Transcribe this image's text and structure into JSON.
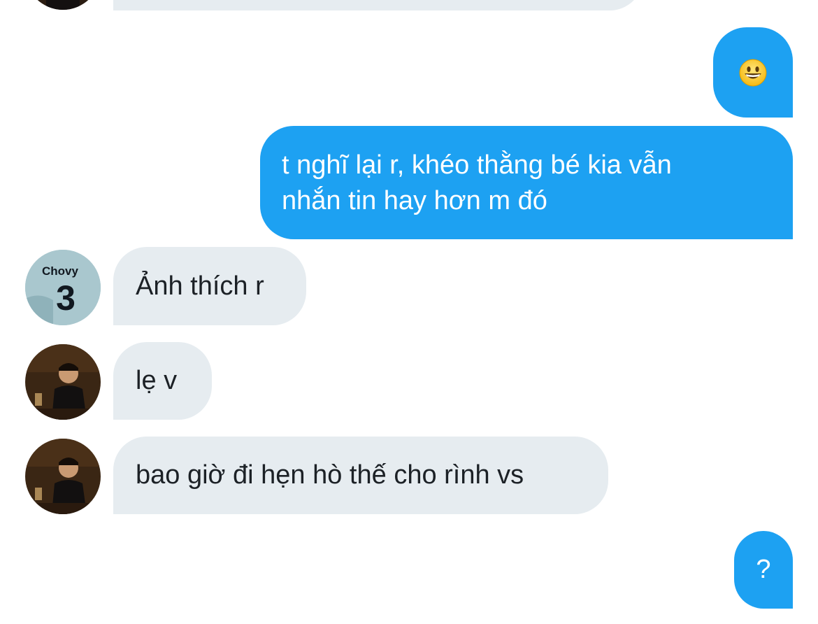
{
  "conversation": {
    "messages": [
      {
        "id": "m1",
        "direction": "incoming",
        "sender_avatar": "dark-photo-avatar",
        "text": ""
      },
      {
        "id": "m2",
        "direction": "outgoing",
        "emoji": "😀",
        "icon": "grinning-face-emoji"
      },
      {
        "id": "m3",
        "direction": "outgoing",
        "lines": [
          "t nghĩ lại r, khéo thằng bé kia vẫn",
          "nhắn tin hay hơn m đó"
        ]
      },
      {
        "id": "m4",
        "direction": "incoming",
        "sender_avatar": "chovy-jersey-avatar",
        "text": "Ảnh thích r"
      },
      {
        "id": "m5",
        "direction": "incoming",
        "sender_avatar": "dark-photo-avatar",
        "text": "lẹ v"
      },
      {
        "id": "m6",
        "direction": "incoming",
        "sender_avatar": "dark-photo-avatar",
        "text": "bao giờ đi hẹn hò thế cho rình vs"
      },
      {
        "id": "m7",
        "direction": "outgoing",
        "text": "?"
      }
    ],
    "avatars": {
      "chovy_jersey_text": "Chovy",
      "chovy_jersey_number": "3"
    }
  },
  "colors": {
    "outgoing_bubble": "#1da1f2",
    "incoming_bubble": "#e6ecf0",
    "incoming_text": "#1c2126",
    "outgoing_text": "#ffffff"
  }
}
